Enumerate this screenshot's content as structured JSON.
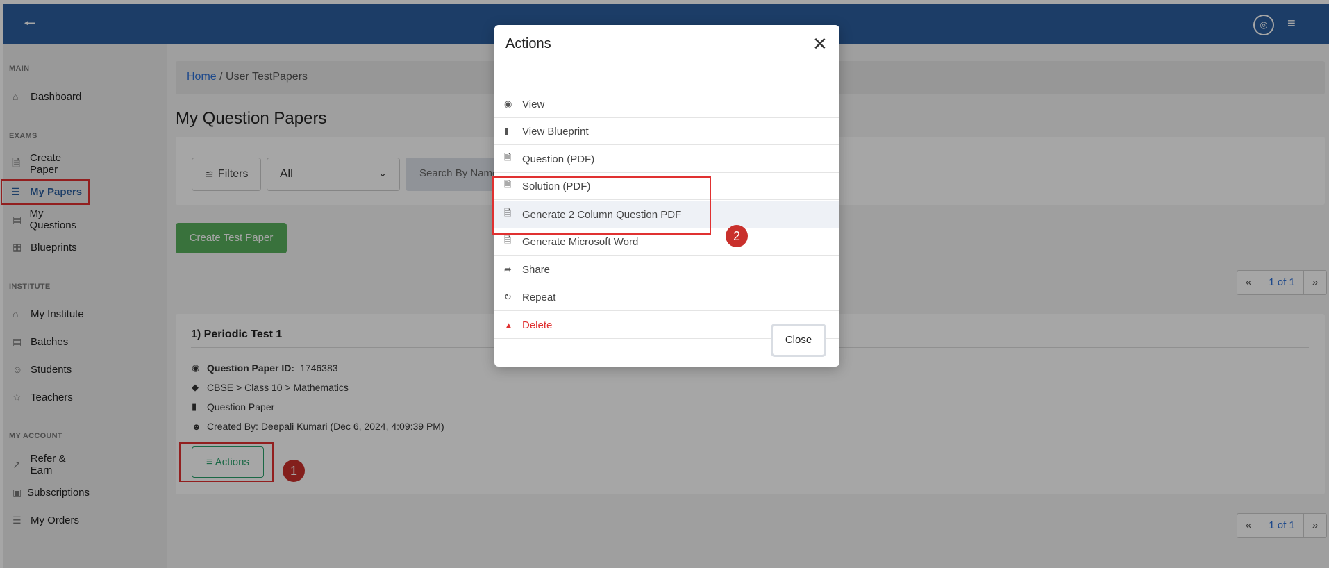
{
  "topbar": {
    "back_icon": "arrow-left-icon",
    "settings_icon": "settings-icon",
    "menu_icon": "hamburger-icon",
    "color": "#2b5f9e"
  },
  "sidebar": {
    "sections": [
      {
        "title": "MAIN",
        "items": [
          {
            "label": "Dashboard",
            "icon": "home-icon"
          }
        ]
      },
      {
        "title": "EXAMS",
        "items": [
          {
            "label": "Create Paper",
            "icon": "file-plus-icon"
          },
          {
            "label": "My Papers",
            "icon": "layers-icon",
            "active": true
          },
          {
            "label": "My Questions",
            "icon": "archive-icon"
          },
          {
            "label": "Blueprints",
            "icon": "calendar-icon"
          }
        ]
      },
      {
        "title": "INSTITUTE",
        "items": [
          {
            "label": "My Institute",
            "icon": "home-icon"
          },
          {
            "label": "Batches",
            "icon": "server-icon"
          },
          {
            "label": "Students",
            "icon": "users-icon"
          },
          {
            "label": "Teachers",
            "icon": "star-icon"
          }
        ]
      },
      {
        "title": "MY ACCOUNT",
        "items": [
          {
            "label": "Refer & Earn",
            "icon": "trending-up-icon"
          },
          {
            "label": "Subscriptions",
            "icon": "box-icon"
          },
          {
            "label": "My Orders",
            "icon": "layers-icon"
          }
        ]
      }
    ]
  },
  "breadcrumb": {
    "home": "Home",
    "separator": "/",
    "current": "User TestPapers"
  },
  "page_title": "My Question Papers",
  "filters": {
    "button_label": "Filters",
    "select_value": "All",
    "search_placeholder": "Search By Name"
  },
  "create_button": "Create Test Paper",
  "pagination": {
    "first": "«",
    "current": "1 of 1",
    "last": "»"
  },
  "paper": {
    "title": "1) Periodic Test 1",
    "id_label": "Question Paper ID:",
    "id_value": "1746383",
    "path": "CBSE > Class 10 > Mathematics",
    "type": "Question Paper",
    "created_by": "Created By: Deepali Kumari (Dec 6, 2024, 4:09:39 PM)",
    "actions_label": "Actions"
  },
  "annotations": {
    "badge1": "1",
    "badge2": "2",
    "highlight_color": "#e03131"
  },
  "modal": {
    "title": "Actions",
    "items": [
      {
        "label": "View",
        "icon": "eye-icon"
      },
      {
        "label": "View Blueprint",
        "icon": "file-text-icon"
      },
      {
        "label": "Question (PDF)",
        "icon": "pdf-icon"
      },
      {
        "label": "Solution (PDF)",
        "icon": "pdf-icon"
      },
      {
        "label": "Generate 2 Column Question PDF",
        "icon": "pdf-icon",
        "highlighted": true
      },
      {
        "label": "Generate Microsoft Word",
        "icon": "pdf-icon"
      },
      {
        "label": "Share",
        "icon": "share-icon"
      },
      {
        "label": "Repeat",
        "icon": "repeat-icon"
      },
      {
        "label": "Delete",
        "icon": "trash-icon",
        "danger": true
      }
    ],
    "close_label": "Close"
  }
}
